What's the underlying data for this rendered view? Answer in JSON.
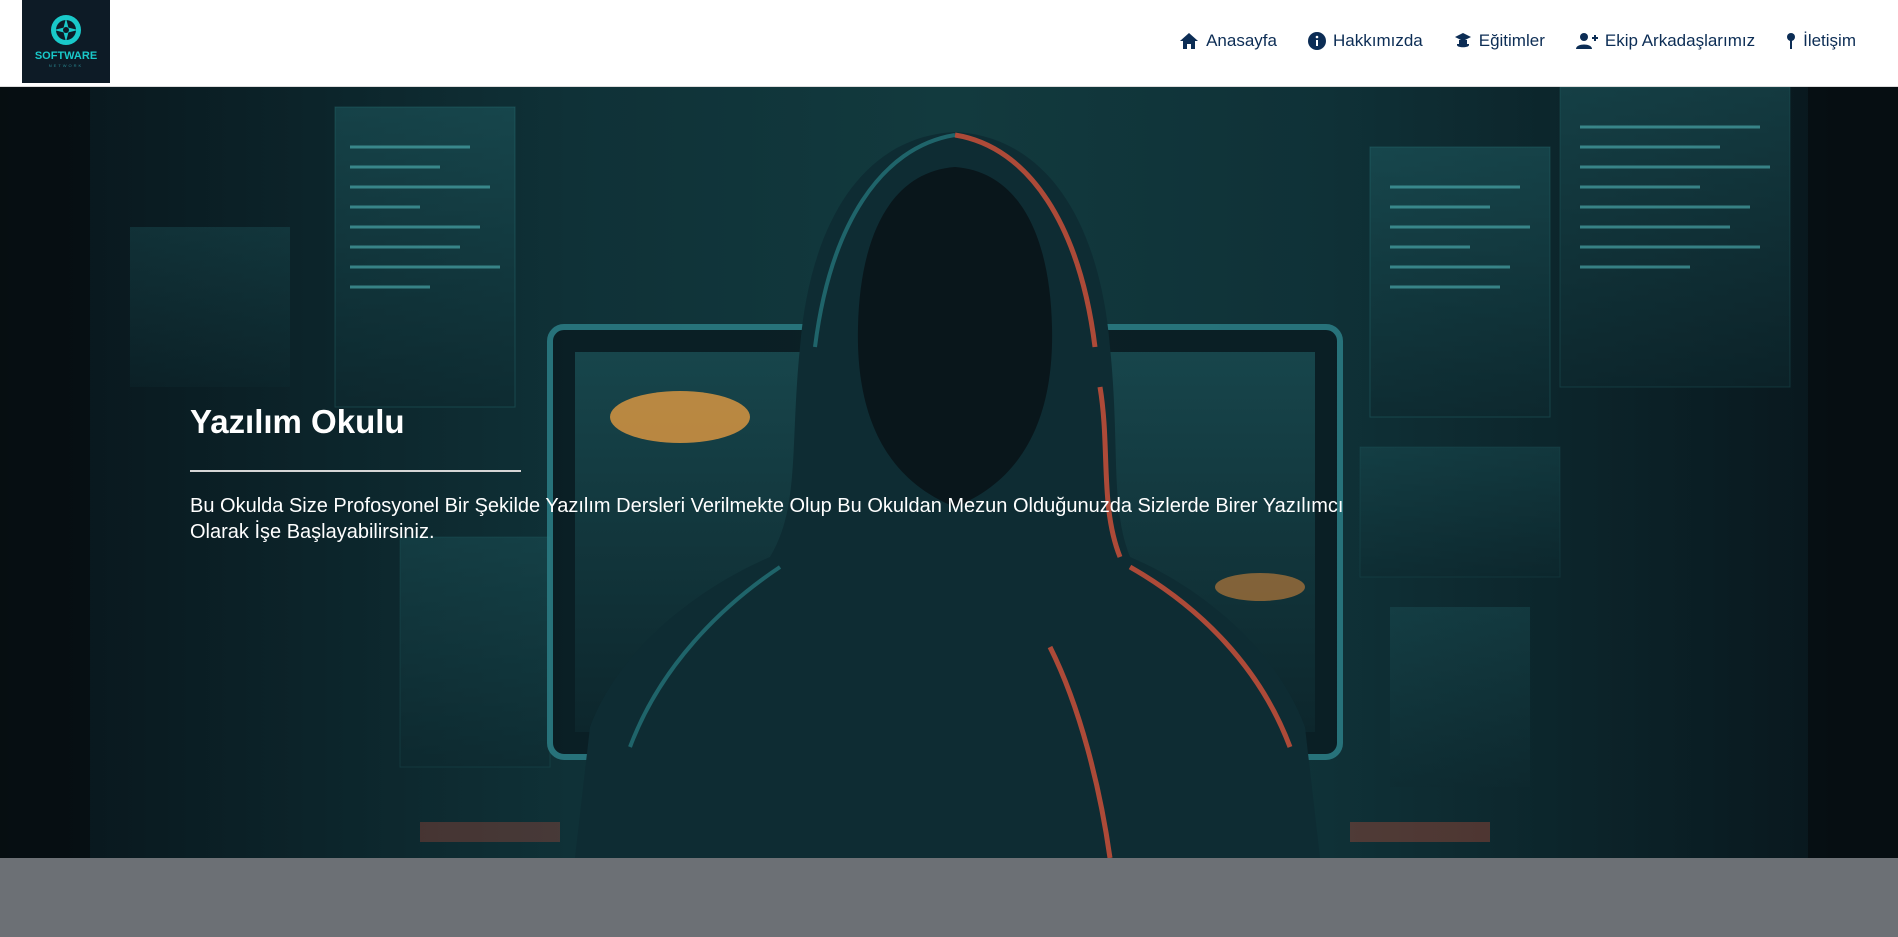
{
  "brand": {
    "logo_text": "SOFTWARE",
    "logo_subtext": "NETWORK"
  },
  "nav": {
    "items": [
      {
        "label": "Anasayfa",
        "icon": "home-icon"
      },
      {
        "label": "Hakkımızda",
        "icon": "info-circle-icon"
      },
      {
        "label": "Eğitimler",
        "icon": "graduate-icon"
      },
      {
        "label": "Ekip Arkadaşlarımız",
        "icon": "user-plus-icon"
      },
      {
        "label": "İletişim",
        "icon": "map-pin-icon"
      }
    ]
  },
  "hero": {
    "title": "Yazılım Okulu",
    "description": "Bu Okulda Size Profosyonel Bir Şekilde Yazılım Dersleri Verilmekte Olup Bu Okuldan Mezun Olduğunuzda Sizlerde Birer Yazılımcı Olarak İşe Başlayabilirsiniz."
  },
  "colors": {
    "nav_text": "#0c2d55",
    "logo_bg": "#0d1b26",
    "logo_accent": "#19c9c9",
    "footer_band": "#6c7075",
    "hoodie_red": "#c9503a"
  }
}
